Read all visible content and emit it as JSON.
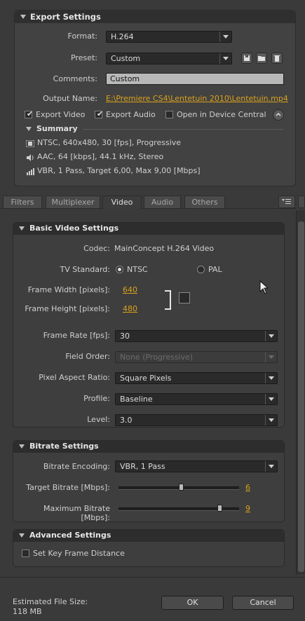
{
  "export_settings": {
    "title": "Export Settings",
    "format_label": "Format:",
    "format_value": "H.264",
    "preset_label": "Preset:",
    "preset_value": "Custom",
    "comments_label": "Comments:",
    "comments_value": "Custom",
    "output_label": "Output Name:",
    "output_value": "E:\\Premiere CS4\\Lentetuin 2010\\Lentetuin.mp4",
    "export_video_label": "Export Video",
    "export_audio_label": "Export Audio",
    "open_device_label": "Open in Device Central",
    "summary_title": "Summary",
    "summary_video": "NTSC, 640x480, 30 [fps], Progressive",
    "summary_audio": "AAC, 64 [kbps], 44.1 kHz, Stereo",
    "summary_bitrate": "VBR, 1 Pass, Target 6,00, Max 9,00 [Mbps]"
  },
  "tabs": [
    "Filters",
    "Multiplexer",
    "Video",
    "Audio",
    "Others"
  ],
  "basic_video": {
    "title": "Basic Video Settings",
    "codec_label": "Codec:",
    "codec_value": "MainConcept H.264 Video",
    "tv_label": "TV Standard:",
    "ntsc": "NTSC",
    "pal": "PAL",
    "width_label": "Frame Width [pixels]:",
    "width_value": "640",
    "height_label": "Frame Height [pixels]:",
    "height_value": "480",
    "frame_rate_label": "Frame Rate [fps]:",
    "frame_rate_value": "30",
    "field_order_label": "Field Order:",
    "field_order_value": "None (Progressive)",
    "par_label": "Pixel Aspect Ratio:",
    "par_value": "Square Pixels",
    "profile_label": "Profile:",
    "profile_value": "Baseline",
    "level_label": "Level:",
    "level_value": "3.0"
  },
  "bitrate": {
    "title": "Bitrate Settings",
    "encoding_label": "Bitrate Encoding:",
    "encoding_value": "VBR, 1 Pass",
    "target_label": "Target Bitrate [Mbps]:",
    "target_value": "6",
    "target_fraction": 0.52,
    "max_label": "Maximum Bitrate [Mbps]:",
    "max_value": "9",
    "max_fraction": 0.84
  },
  "advanced": {
    "title": "Advanced Settings",
    "keyframe_label": "Set Key Frame Distance"
  },
  "footer": {
    "estimate_label": "Estimated File Size:",
    "estimate_value": "118 MB",
    "ok": "OK",
    "cancel": "Cancel"
  },
  "colors": {
    "accent_link": "#d9a11b",
    "panel": "#424242",
    "background": "#3a3a3a"
  }
}
